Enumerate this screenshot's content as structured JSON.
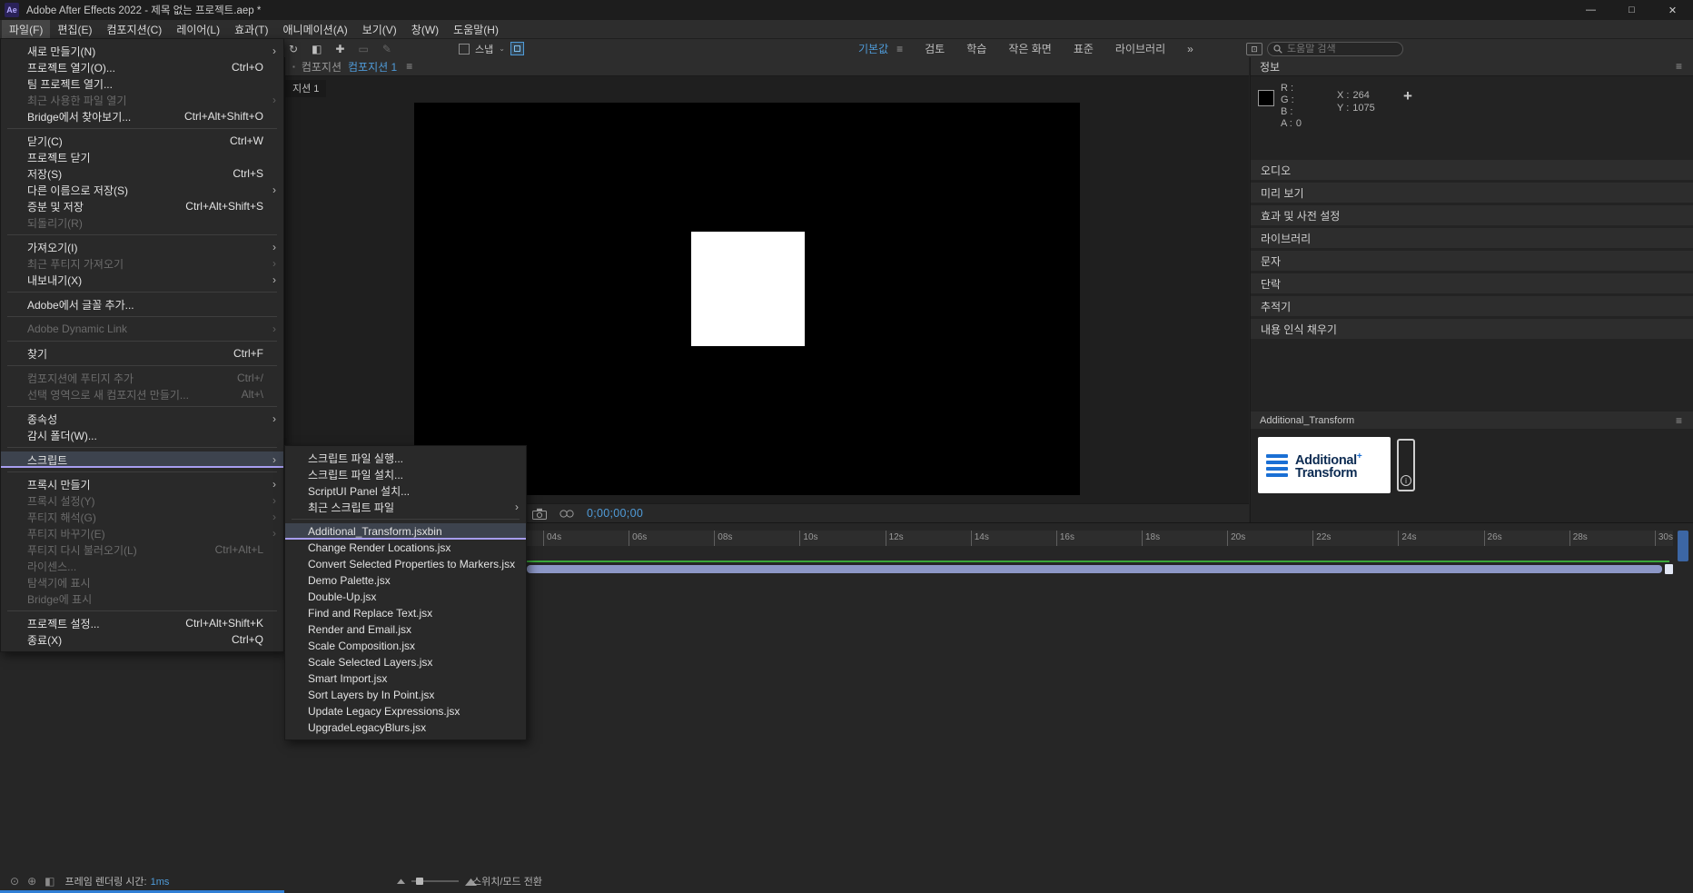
{
  "window": {
    "title": "Adobe After Effects 2022 - 제목 없는 프로젝트.aep *",
    "logo": "Ae",
    "controls": {
      "minimize": "—",
      "maximize": "□",
      "close": "✕"
    }
  },
  "menubar": {
    "items": [
      {
        "label": "파일(F)",
        "active": true
      },
      {
        "label": "편집(E)"
      },
      {
        "label": "컴포지션(C)"
      },
      {
        "label": "레이어(L)"
      },
      {
        "label": "효과(T)"
      },
      {
        "label": "애니메이션(A)"
      },
      {
        "label": "보기(V)"
      },
      {
        "label": "창(W)"
      },
      {
        "label": "도움말(H)"
      }
    ]
  },
  "toolbar": {
    "tools": [
      {
        "glyph": "↻"
      },
      {
        "glyph": "◧"
      },
      {
        "glyph": "✚"
      },
      {
        "glyph": "▭",
        "disabled": true
      },
      {
        "glyph": "✎",
        "disabled": true
      }
    ],
    "snap_label": "스냅",
    "snap_chevron": "⌄",
    "workspaces": [
      {
        "label": "기본값",
        "active": true,
        "menu_icon": true,
        "ham": "≡"
      },
      {
        "label": "검토"
      },
      {
        "label": "학습"
      },
      {
        "label": "작은 화면"
      },
      {
        "label": "표준"
      },
      {
        "label": "라이브러리"
      },
      {
        "label": "»"
      }
    ],
    "search_placeholder": "도움말 검색"
  },
  "file_menu": {
    "items": [
      {
        "label": "새로 만들기(N)",
        "has_submenu": true
      },
      {
        "label": "프로젝트 열기(O)...",
        "shortcut": "Ctrl+O"
      },
      {
        "label": "팀 프로젝트 열기..."
      },
      {
        "label": "최근 사용한 파일 열기",
        "disabled": true,
        "has_submenu": true
      },
      {
        "label": "Bridge에서 찾아보기...",
        "shortcut": "Ctrl+Alt+Shift+O"
      },
      {
        "separator": true
      },
      {
        "label": "닫기(C)",
        "shortcut": "Ctrl+W"
      },
      {
        "label": "프로젝트 닫기"
      },
      {
        "label": "저장(S)",
        "shortcut": "Ctrl+S"
      },
      {
        "label": "다른 이름으로 저장(S)",
        "has_submenu": true
      },
      {
        "label": "증분 및 저장",
        "shortcut": "Ctrl+Alt+Shift+S"
      },
      {
        "label": "되돌리기(R)",
        "disabled": true
      },
      {
        "separator": true
      },
      {
        "label": "가져오기(I)",
        "has_submenu": true
      },
      {
        "label": "최근 푸티지 가져오기",
        "disabled": true,
        "has_submenu": true
      },
      {
        "label": "내보내기(X)",
        "has_submenu": true
      },
      {
        "separator": true
      },
      {
        "label": "Adobe에서 글꼴 추가..."
      },
      {
        "separator": true
      },
      {
        "label": "Adobe Dynamic Link",
        "disabled": true,
        "has_submenu": true
      },
      {
        "separator": true
      },
      {
        "label": "찾기",
        "shortcut": "Ctrl+F"
      },
      {
        "separator": true
      },
      {
        "label": "컴포지션에 푸티지 추가",
        "shortcut": "Ctrl+/",
        "disabled": true
      },
      {
        "label": "선택 영역으로 새 컴포지션 만들기...",
        "shortcut": "Alt+\\",
        "disabled": true
      },
      {
        "separator": true
      },
      {
        "label": "종속성",
        "has_submenu": true
      },
      {
        "label": "감시 폴더(W)..."
      },
      {
        "separator": true
      },
      {
        "label": "스크립트",
        "has_submenu": true,
        "highlighted": true
      },
      {
        "separator": true
      },
      {
        "label": "프록시 만들기",
        "has_submenu": true
      },
      {
        "label": "프록시 설정(Y)",
        "disabled": true,
        "has_submenu": true
      },
      {
        "label": "푸티지 해석(G)",
        "disabled": true,
        "has_submenu": true
      },
      {
        "label": "푸티지 바꾸기(E)",
        "disabled": true,
        "has_submenu": true
      },
      {
        "label": "푸티지 다시 불러오기(L)",
        "shortcut": "Ctrl+Alt+L",
        "disabled": true
      },
      {
        "label": "라이센스...",
        "disabled": true
      },
      {
        "label": "탐색기에 표시",
        "disabled": true
      },
      {
        "label": "Bridge에 표시",
        "disabled": true
      },
      {
        "separator": true
      },
      {
        "label": "프로젝트 설정...",
        "shortcut": "Ctrl+Alt+Shift+K"
      },
      {
        "label": "종료(X)",
        "shortcut": "Ctrl+Q"
      }
    ]
  },
  "scripts_submenu": {
    "items": [
      {
        "label": "스크립트 파일 실행..."
      },
      {
        "label": "스크립트 파일 설치..."
      },
      {
        "label": "ScriptUI Panel 설치..."
      },
      {
        "label": "최근 스크립트 파일",
        "has_submenu": true
      },
      {
        "separator": true
      },
      {
        "label": "Additional_Transform.jsxbin",
        "highlighted": true
      },
      {
        "label": "Change Render Locations.jsx"
      },
      {
        "label": "Convert Selected Properties to Markers.jsx"
      },
      {
        "label": "Demo Palette.jsx"
      },
      {
        "label": "Double-Up.jsx"
      },
      {
        "label": "Find and Replace Text.jsx"
      },
      {
        "label": "Render and Email.jsx"
      },
      {
        "label": "Scale Composition.jsx"
      },
      {
        "label": "Scale Selected Layers.jsx"
      },
      {
        "label": "Smart Import.jsx"
      },
      {
        "label": "Sort Layers by In Point.jsx"
      },
      {
        "label": "Update Legacy Expressions.jsx"
      },
      {
        "label": "UpgradeLegacyBlurs.jsx"
      }
    ]
  },
  "composition_panel": {
    "grip": "▪",
    "panel_label": "컴포지션",
    "active_tab": "컴포지션 1",
    "panel_menu": "≡",
    "mini_tab": "지션 1",
    "timecode": "0;00;00;00"
  },
  "info_panel": {
    "title": "정보",
    "panel_menu": "≡",
    "rgba": [
      {
        "label": "R :",
        "value": ""
      },
      {
        "label": "G :",
        "value": ""
      },
      {
        "label": "B :",
        "value": ""
      },
      {
        "label": "A :",
        "value": "0"
      }
    ],
    "x_label": "X :",
    "x_value": "264",
    "y_label": "Y :",
    "y_value": "1075",
    "crosshair": "+"
  },
  "right_panels": [
    "오디오",
    "미리 보기",
    "효과 및 사전 설정",
    "라이브러리",
    "문자",
    "단락",
    "추적기",
    "내용 인식 채우기"
  ],
  "at_panel": {
    "header": "Additional_Transform",
    "panel_menu": "≡",
    "logo_word1": "Additional",
    "logo_plus": "+",
    "logo_word2": "Transform",
    "info_i": "i"
  },
  "timeline": {
    "ruler_labels": [
      "04s",
      "06s",
      "08s",
      "10s",
      "12s",
      "14s",
      "16s",
      "18s",
      "20s",
      "22s",
      "24s",
      "26s",
      "28s",
      "30s"
    ]
  },
  "statusbar": {
    "icons": [
      "⊙",
      "⊕",
      "◧"
    ],
    "render_time_label": "프레임 렌더링 시간:",
    "render_time_value": "1ms",
    "toggle_label": "스위치/모드 전환"
  }
}
